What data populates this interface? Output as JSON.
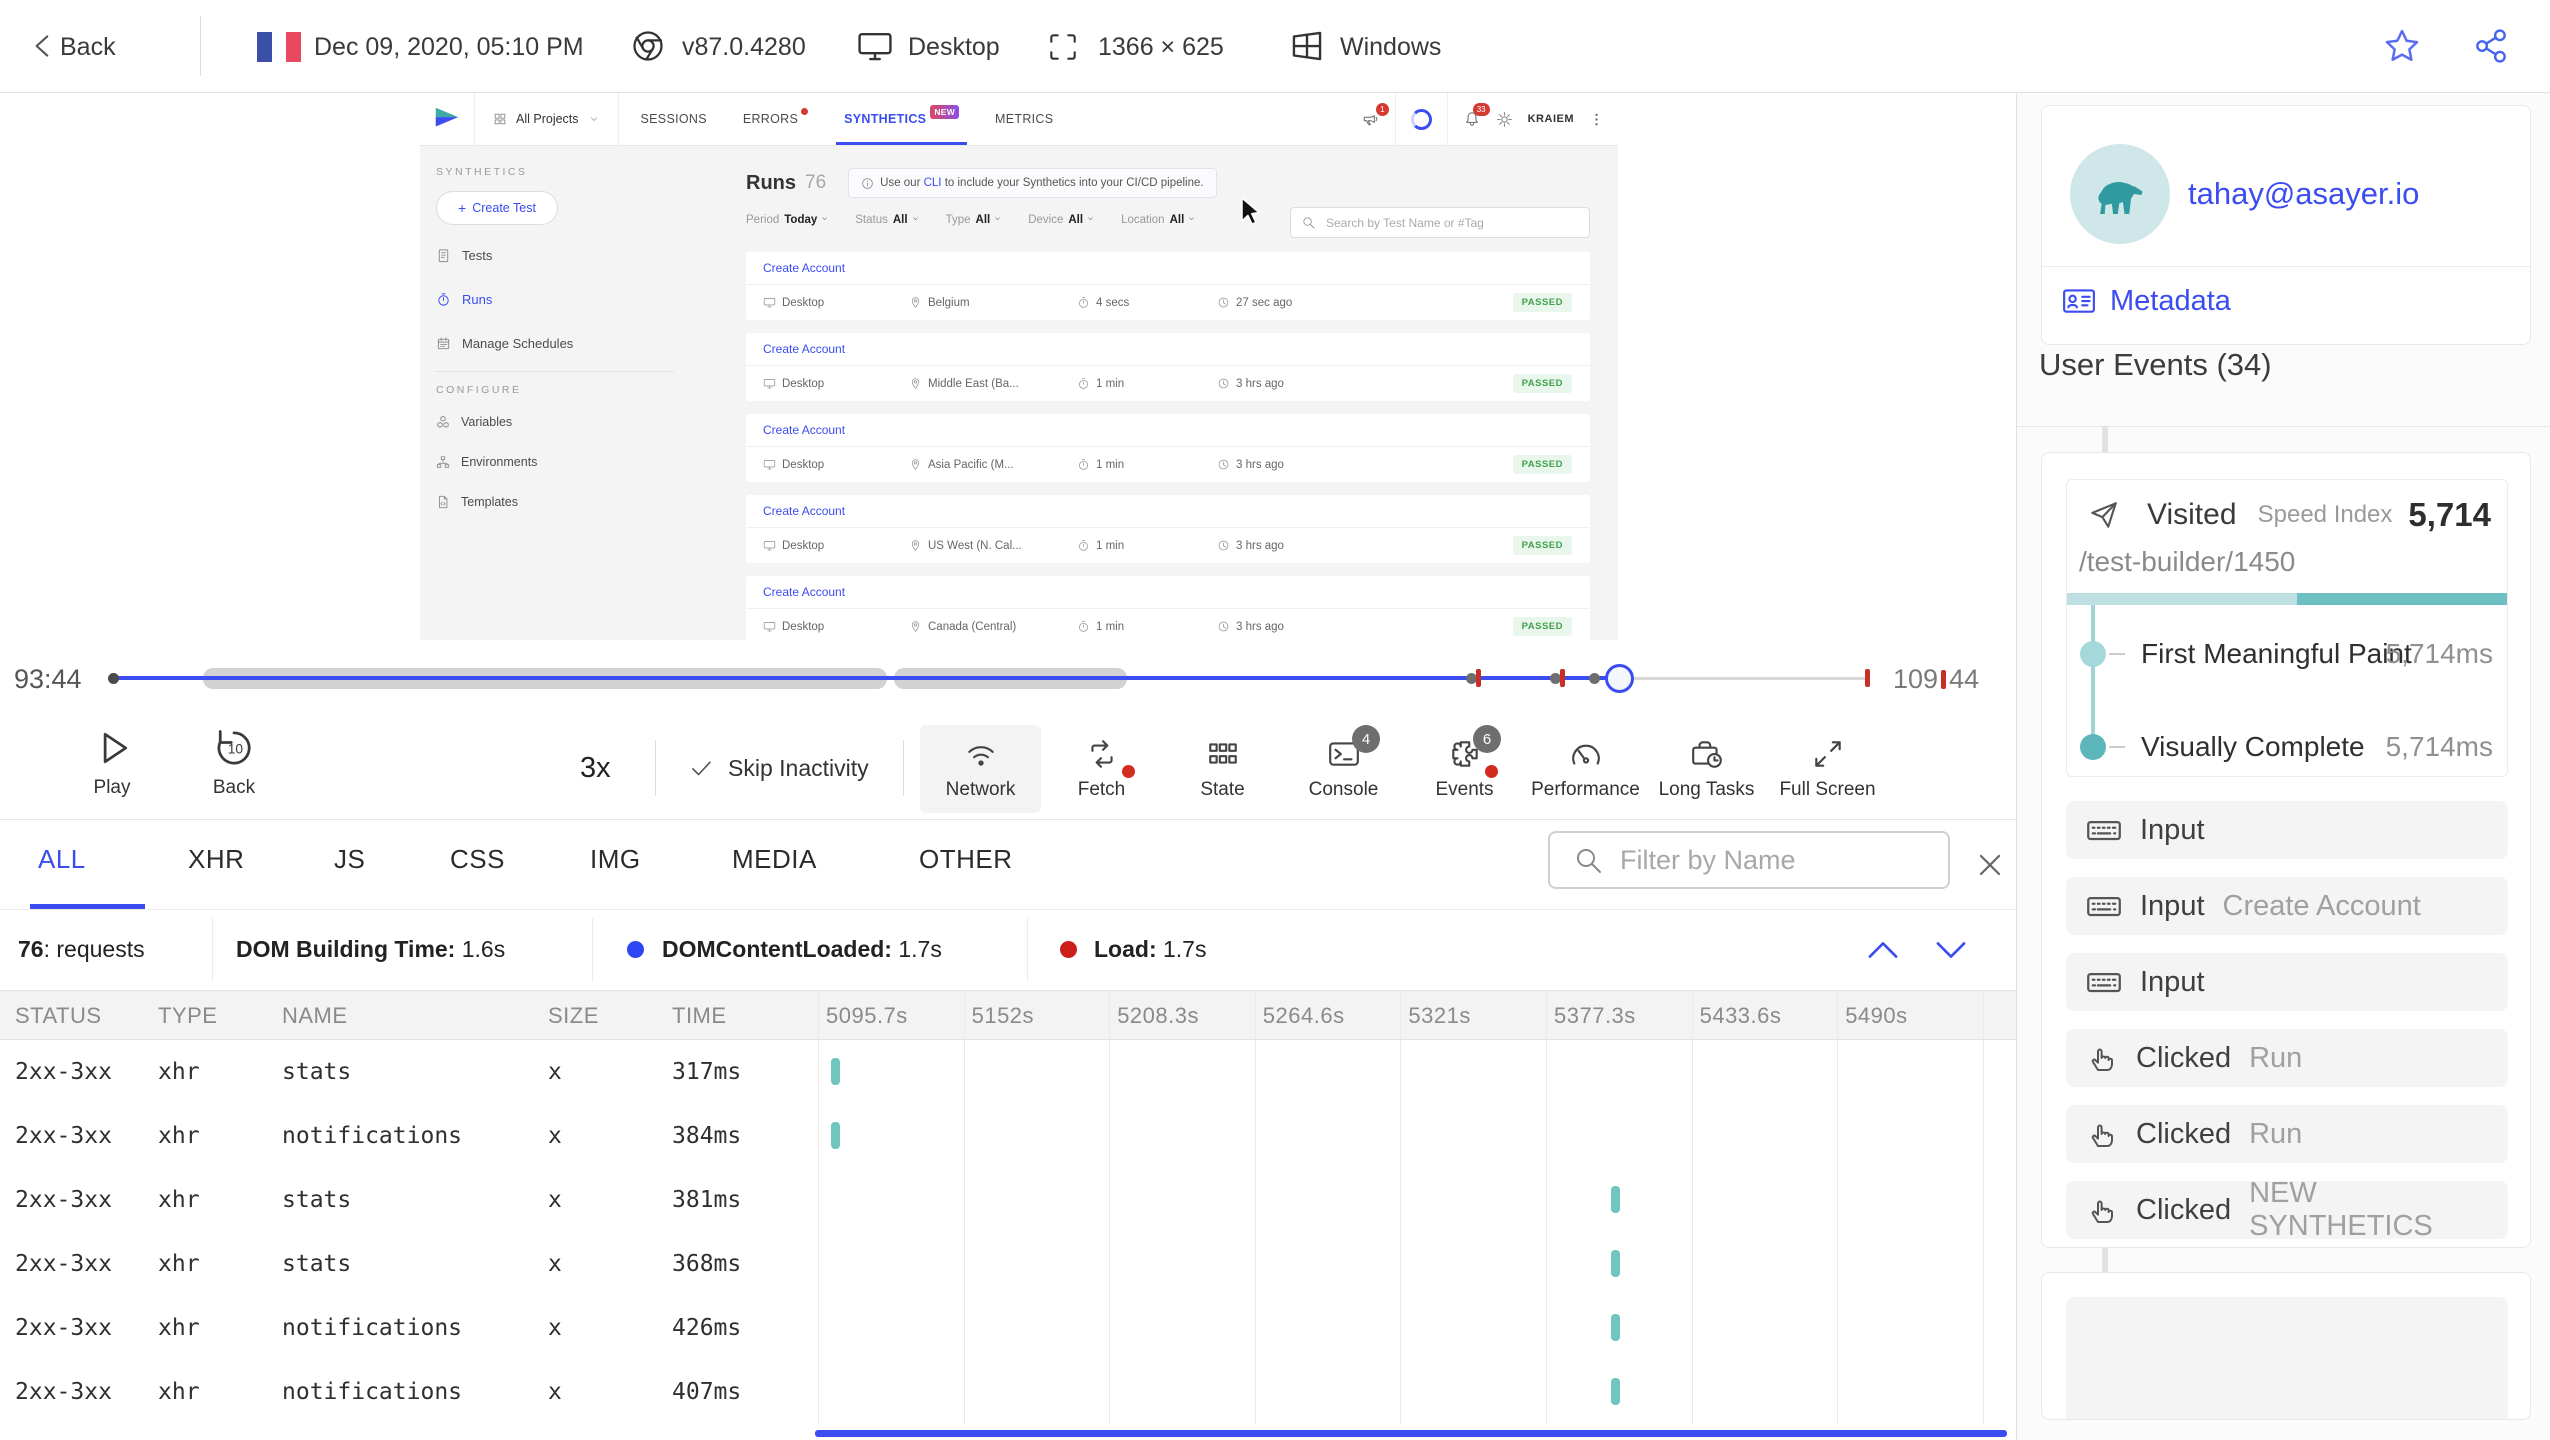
{
  "colors": {
    "accent": "#3b4cf0",
    "teal": "#70c5bf",
    "red": "#d22c20",
    "green": "#42a04e"
  },
  "top_bar": {
    "back_label": "Back",
    "date": "Dec 09, 2020, 05:10 PM",
    "browser_version": "v87.0.4280",
    "device_label": "Desktop",
    "resolution": "1366 × 625",
    "os_label": "Windows"
  },
  "app": {
    "nav": {
      "projects_label": "All Projects",
      "tabs": [
        {
          "label": "SESSIONS"
        },
        {
          "label": "ERRORS",
          "dot": true
        },
        {
          "label": "SYNTHETICS",
          "active": true,
          "badge": "NEW"
        },
        {
          "label": "METRICS"
        }
      ],
      "announce_badge": "1",
      "bell_badge": "33",
      "user": "KRAIEM"
    },
    "sidebar": {
      "section_synthetics": "SYNTHETICS",
      "create_test": "Create Test",
      "items": [
        {
          "label": "Tests",
          "icon": "clipboard"
        },
        {
          "label": "Runs",
          "icon": "stopwatch",
          "active": true
        },
        {
          "label": "Manage Schedules",
          "icon": "calendar"
        }
      ],
      "section_configure": "CONFIGURE",
      "configure_items": [
        {
          "label": "Variables",
          "icon": "cubes"
        },
        {
          "label": "Environments",
          "icon": "sitemap"
        },
        {
          "label": "Templates",
          "icon": "filecode"
        }
      ]
    },
    "content": {
      "title": "Runs",
      "count": "76",
      "banner": {
        "prefix": "Use our ",
        "link": "CLI",
        "suffix": " to include your Synthetics into your CI/CD pipeline."
      },
      "filters": [
        {
          "label": "Period",
          "value": "Today"
        },
        {
          "label": "Status",
          "value": "All"
        },
        {
          "label": "Type",
          "value": "All"
        },
        {
          "label": "Device",
          "value": "All"
        },
        {
          "label": "Location",
          "value": "All"
        }
      ],
      "search_placeholder": "Search by Test Name or #Tag",
      "runs": [
        {
          "name": "Create Account",
          "device": "Desktop",
          "location": "Belgium",
          "duration": "4 secs",
          "ago": "27 sec ago",
          "status": "PASSED"
        },
        {
          "name": "Create Account",
          "device": "Desktop",
          "location": "Middle East (Ba...",
          "duration": "1 min",
          "ago": "3 hrs ago",
          "status": "PASSED"
        },
        {
          "name": "Create Account",
          "device": "Desktop",
          "location": "Asia Pacific (M...",
          "duration": "1 min",
          "ago": "3 hrs ago",
          "status": "PASSED"
        },
        {
          "name": "Create Account",
          "device": "Desktop",
          "location": "US West (N. Cal...",
          "duration": "1 min",
          "ago": "3 hrs ago",
          "status": "PASSED"
        },
        {
          "name": "Create Account",
          "device": "Desktop",
          "location": "Canada (Central)",
          "duration": "1 min",
          "ago": "3 hrs ago",
          "status": "PASSED"
        }
      ]
    }
  },
  "timeline": {
    "current": "93:44",
    "end_prefix": "109",
    "end_suffix": "44"
  },
  "controls": {
    "play": "Play",
    "back": "Back",
    "back_amount": "10",
    "speed": "3x",
    "skip": "Skip Inactivity",
    "buttons": [
      {
        "label": "Network",
        "icon": "wifi",
        "active": true
      },
      {
        "label": "Fetch",
        "icon": "fetch",
        "red_dot": true
      },
      {
        "label": "State",
        "icon": "stategrid"
      },
      {
        "label": "Console",
        "icon": "console",
        "badge": "4"
      },
      {
        "label": "Events",
        "icon": "puzzle",
        "badge": "6",
        "red_dot": true
      },
      {
        "label": "Performance",
        "icon": "gauge"
      },
      {
        "label": "Long Tasks",
        "icon": "briefcase"
      },
      {
        "label": "Full Screen",
        "icon": "expand"
      }
    ]
  },
  "network": {
    "tabs": [
      {
        "label": "ALL",
        "active": true
      },
      {
        "label": "XHR"
      },
      {
        "label": "JS"
      },
      {
        "label": "CSS"
      },
      {
        "label": "IMG"
      },
      {
        "label": "MEDIA"
      },
      {
        "label": "OTHER"
      }
    ],
    "filter_placeholder": "Filter by Name",
    "stats": {
      "requests_value": "76",
      "requests_label": ": requests",
      "dom_label": "DOM Building Time:",
      "dom_value": "1.6s",
      "dcl_label": "DOMContentLoaded:",
      "dcl_value": "1.7s",
      "load_label": "Load:",
      "load_value": "1.7s"
    },
    "columns": [
      "STATUS",
      "TYPE",
      "NAME",
      "SIZE",
      "TIME"
    ],
    "time_columns": [
      "5095.7s",
      "5152s",
      "5208.3s",
      "5264.6s",
      "5321s",
      "5377.3s",
      "5433.6s",
      "5490s"
    ],
    "rows": [
      {
        "status": "2xx-3xx",
        "type": "xhr",
        "name": "stats",
        "size": "x",
        "time": "317ms",
        "bar_frac": 0.011
      },
      {
        "status": "2xx-3xx",
        "type": "xhr",
        "name": "notifications",
        "size": "x",
        "time": "384ms",
        "bar_frac": 0.011
      },
      {
        "status": "2xx-3xx",
        "type": "xhr",
        "name": "stats",
        "size": "x",
        "time": "381ms",
        "bar_frac": 0.681
      },
      {
        "status": "2xx-3xx",
        "type": "xhr",
        "name": "stats",
        "size": "x",
        "time": "368ms",
        "bar_frac": 0.681
      },
      {
        "status": "2xx-3xx",
        "type": "xhr",
        "name": "notifications",
        "size": "x",
        "time": "426ms",
        "bar_frac": 0.681
      },
      {
        "status": "2xx-3xx",
        "type": "xhr",
        "name": "notifications",
        "size": "x",
        "time": "407ms",
        "bar_frac": 0.681
      }
    ]
  },
  "user_panel": {
    "email": "tahay@asayer.io",
    "metadata_label": "Metadata",
    "events_title": "User Events (34)",
    "visited": {
      "label": "Visited",
      "speed_index_label": "Speed Index",
      "speed_index_value": "5,714",
      "url": "/test-builder/1450",
      "metrics": [
        {
          "label": "First Meaningful Paint",
          "value": "5,714ms"
        },
        {
          "label": "Visually Complete",
          "value": "5,714ms"
        }
      ]
    },
    "events": [
      {
        "icon": "keyboard",
        "label": "Input",
        "detail": ""
      },
      {
        "icon": "keyboard",
        "label": "Input",
        "detail": "Create Account"
      },
      {
        "icon": "keyboard",
        "label": "Input",
        "detail": ""
      },
      {
        "icon": "hand",
        "label": "Clicked",
        "detail": "Run"
      },
      {
        "icon": "hand",
        "label": "Clicked",
        "detail": "Run"
      },
      {
        "icon": "hand",
        "label": "Clicked",
        "detail": "NEW SYNTHETICS"
      }
    ]
  }
}
